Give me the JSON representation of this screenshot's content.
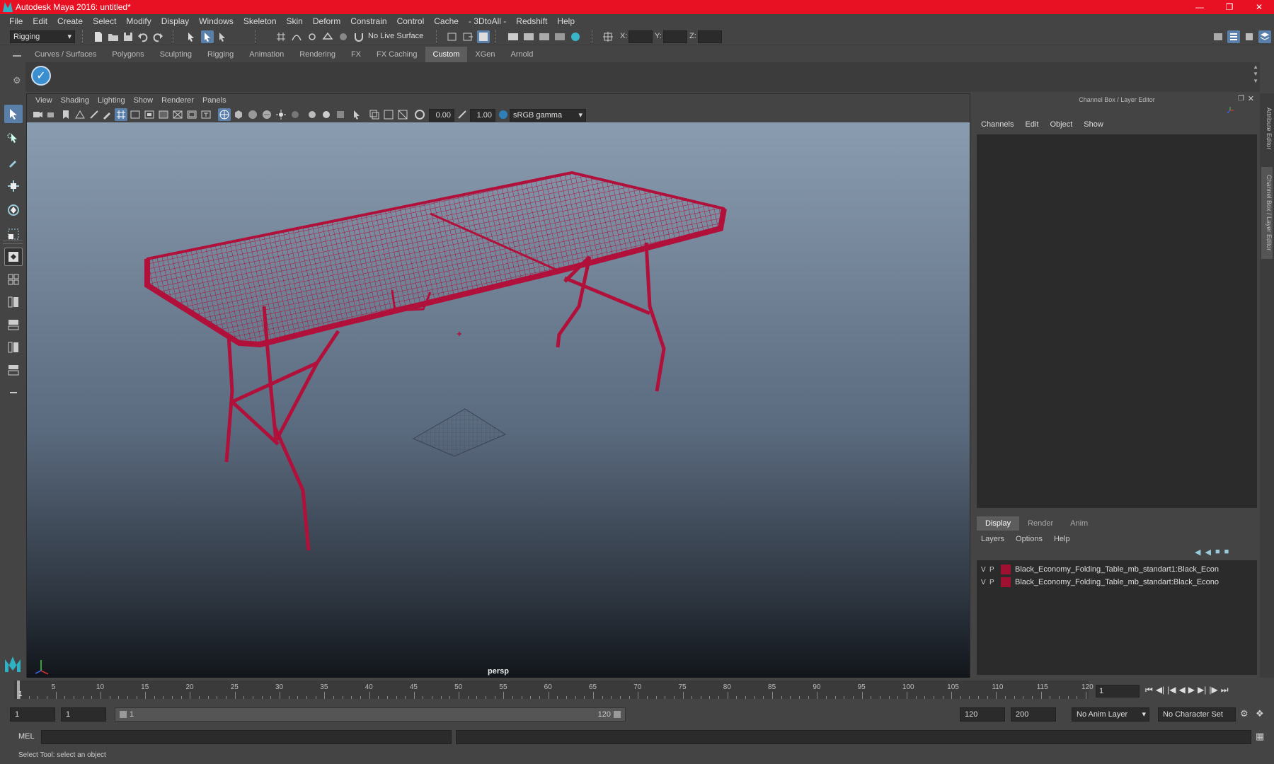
{
  "window": {
    "title": "Autodesk Maya 2016: untitled*"
  },
  "menubar": [
    "File",
    "Edit",
    "Create",
    "Select",
    "Modify",
    "Display",
    "Windows",
    "Skeleton",
    "Skin",
    "Deform",
    "Constrain",
    "Control",
    "Cache",
    "- 3DtoAll -",
    "Redshift",
    "Help"
  ],
  "statusline": {
    "menuset": "Rigging",
    "live_surface": "No Live Surface",
    "x_label": "X:",
    "y_label": "Y:",
    "z_label": "Z:"
  },
  "shelf": {
    "tabs": [
      "Curves / Surfaces",
      "Polygons",
      "Sculpting",
      "Rigging",
      "Animation",
      "Rendering",
      "FX",
      "FX Caching",
      "Custom",
      "XGen",
      "Arnold"
    ],
    "active_tab": "Custom"
  },
  "viewport": {
    "menu": [
      "View",
      "Shading",
      "Lighting",
      "Show",
      "Renderer",
      "Panels"
    ],
    "exposure": "0.00",
    "gamma": "1.00",
    "colorspace": "sRGB gamma",
    "camera": "persp"
  },
  "channel_box": {
    "title": "Channel Box / Layer Editor",
    "menu": [
      "Channels",
      "Edit",
      "Object",
      "Show"
    ]
  },
  "layer_editor": {
    "tabs": [
      "Display",
      "Render",
      "Anim"
    ],
    "active_tab": "Display",
    "menu": [
      "Layers",
      "Options",
      "Help"
    ],
    "layers": [
      {
        "v": "V",
        "p": "P",
        "name": "Black_Economy_Folding_Table_mb_standart1:Black_Econ",
        "color": "#a01030"
      },
      {
        "v": "V",
        "p": "P",
        "name": "Black_Economy_Folding_Table_mb_standart:Black_Econo",
        "color": "#a01030"
      }
    ]
  },
  "side_tabs": [
    "Attribute Editor",
    "Channel Box / Layer Editor"
  ],
  "timeline": {
    "ticks": [
      "5",
      "10",
      "15",
      "20",
      "25",
      "30",
      "35",
      "40",
      "45",
      "50",
      "55",
      "60",
      "65",
      "70",
      "75",
      "80",
      "85",
      "90",
      "95",
      "100",
      "105",
      "110",
      "115",
      "120"
    ],
    "current_marker": "1",
    "current_frame": "1"
  },
  "range": {
    "start": "1",
    "playback_start": "1",
    "slider_start": "1",
    "slider_end": "120",
    "playback_end": "120",
    "end": "200",
    "anim_layer": "No Anim Layer",
    "character_set": "No Character Set"
  },
  "command": {
    "language": "MEL"
  },
  "helpline": {
    "text": "Select Tool: select an object"
  },
  "colors": {
    "wireframe": "#b0103a",
    "titlebar": "#e81123",
    "active_tab": "#5d5d5d"
  }
}
